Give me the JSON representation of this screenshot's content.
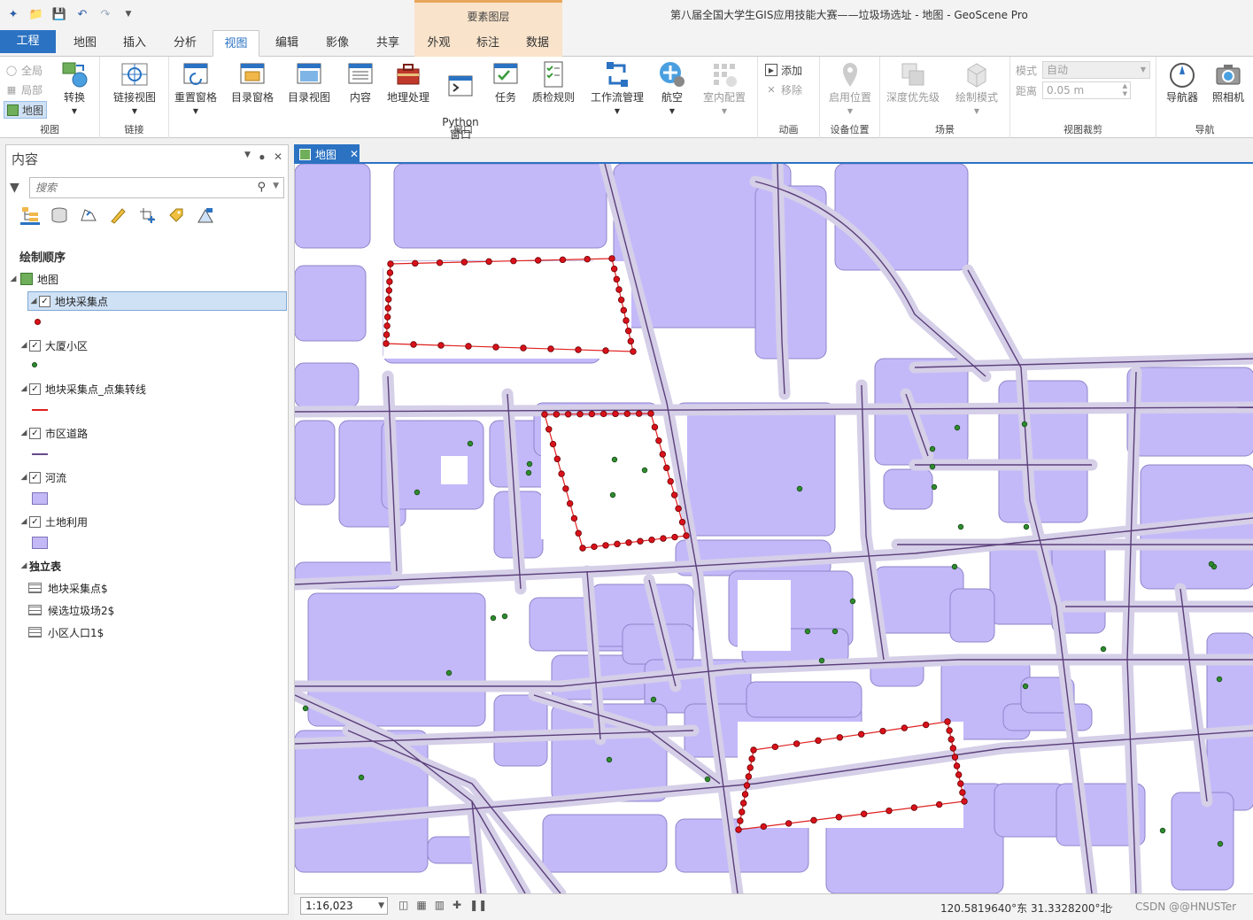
{
  "window": {
    "title": "第八届全国大学生GIS应用技能大赛——垃圾场选址 - 地图 - GeoScene Pro",
    "context_group": "要素图层"
  },
  "quick_access": {
    "icons": [
      "new-project-icon",
      "open-project-icon",
      "save-project-icon",
      "undo-icon",
      "redo-icon",
      "customize-qat-icon"
    ]
  },
  "tabs": {
    "project": "工程",
    "items": [
      "地图",
      "插入",
      "分析",
      "视图",
      "编辑",
      "影像",
      "共享"
    ],
    "context_items": [
      "外观",
      "标注",
      "数据"
    ],
    "active": "视图"
  },
  "ribbon": {
    "view_group": {
      "label": "视图",
      "full": "全局",
      "local": "局部",
      "map": "地图",
      "convert": "转换"
    },
    "link_group": {
      "label": "链接",
      "link_views": "链接视图"
    },
    "windows_group": {
      "label": "窗口",
      "reset_panes": "重置窗格",
      "catalog_pane": "目录窗格",
      "catalog_view": "目录视图",
      "contents": "内容",
      "geoprocessing": "地理处理",
      "python_window": "Python\n窗口",
      "tasks": "任务",
      "qc_rules": "质检规则",
      "workflow_manager": "工作流管理",
      "flight": "航空",
      "indoor_config": "室内配置"
    },
    "animation_group": {
      "label": "动画",
      "add": "添加",
      "remove": "移除"
    },
    "device_group": {
      "label": "设备位置",
      "enable_location": "启用位置"
    },
    "scene_group": {
      "label": "场景",
      "depth_priority": "深度优先级",
      "draw_mode": "绘制模式"
    },
    "clip_group": {
      "label": "视图裁剪",
      "mode_label": "模式",
      "mode_value": "自动",
      "distance_label": "距离",
      "distance_value": "0.05 m"
    },
    "nav_group": {
      "label": "导航",
      "navigator": "导航器",
      "camera": "照相机"
    }
  },
  "contents": {
    "title": "内容",
    "search_placeholder": "搜索",
    "section_title": "绘制顺序",
    "map_name": "地图",
    "layers": [
      {
        "name": "地块采集点",
        "symbol": "point",
        "color": "#d9111b",
        "selected": true
      },
      {
        "name": "大厦小区",
        "symbol": "point",
        "color": "#2e8b2e"
      },
      {
        "name": "地块采集点_点集转线",
        "symbol": "line",
        "color": "#e02020"
      },
      {
        "name": "市区道路",
        "symbol": "line",
        "color": "#6a4a8c"
      },
      {
        "name": "河流",
        "symbol": "fill",
        "color": "#c4b9f7"
      },
      {
        "name": "土地利用",
        "symbol": "fill",
        "color": "#c4b9f7"
      }
    ],
    "standalone_title": "独立表",
    "tables": [
      "地块采集点$",
      "候选垃圾场2$",
      "小区人口1$"
    ]
  },
  "map_view": {
    "tab_label": "地图",
    "colors": {
      "landuse": "#c3b9f9",
      "landuse_stroke": "#8f84c9",
      "road_edge": "#d5cfe8",
      "road": "#5b3f7a",
      "parcel_point": "#d9111b",
      "parcel_line": "#e02020",
      "residential_point": "#2e8b2e"
    }
  },
  "status": {
    "scale": "1:16,023",
    "coordinates": "120.5819640°东 31.3328200°北",
    "watermark": "CSDN @@HNUSTer"
  }
}
